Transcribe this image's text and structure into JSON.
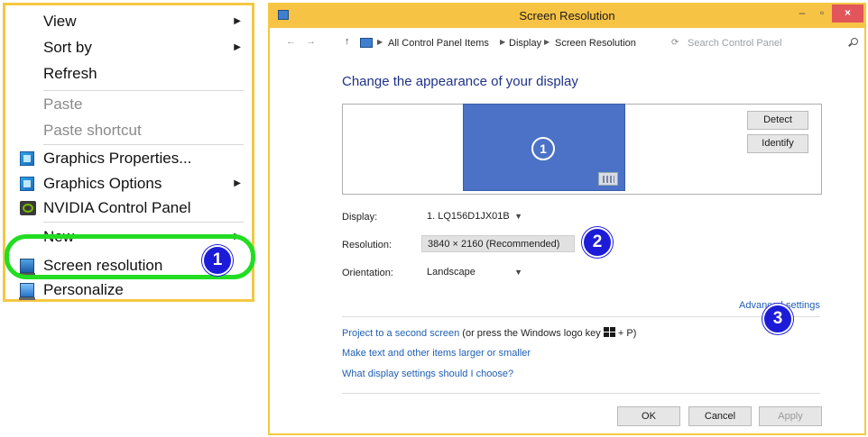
{
  "context_menu": {
    "items": [
      {
        "label": "View",
        "has_submenu": true,
        "disabled": false
      },
      {
        "label": "Sort by",
        "has_submenu": true,
        "disabled": false
      },
      {
        "label": "Refresh",
        "has_submenu": false,
        "disabled": false
      },
      {
        "label": "Paste",
        "has_submenu": false,
        "disabled": true
      },
      {
        "label": "Paste shortcut",
        "has_submenu": false,
        "disabled": true
      },
      {
        "label": "Graphics Properties...",
        "icon": "intel-graphics-icon"
      },
      {
        "label": "Graphics Options",
        "icon": "intel-graphics-icon",
        "has_submenu": true
      },
      {
        "label": "NVIDIA Control Panel",
        "icon": "nvidia-icon"
      },
      {
        "label": "New",
        "has_submenu": true
      },
      {
        "label": "Screen resolution",
        "icon": "screen-resolution-icon",
        "highlighted": true
      },
      {
        "label": "Personalize",
        "icon": "personalize-icon"
      }
    ],
    "highlight_color": "#22dd22"
  },
  "callouts": {
    "one": "1",
    "two": "2",
    "three": "3",
    "color": "#1c1cd8"
  },
  "window": {
    "title": "Screen Resolution",
    "titlebar_color": "#f7c345",
    "controls": {
      "minimize": "–",
      "maximize": "▫",
      "close": "×"
    },
    "address_bar": {
      "nav_back": "←",
      "nav_forward": "→",
      "nav_up": "↑",
      "breadcrumbs": [
        "All Control Panel Items",
        "Display",
        "Screen Resolution"
      ],
      "search_placeholder": "Search Control Panel"
    },
    "heading": "Change the appearance of your display",
    "preview": {
      "monitor_number": "1",
      "detect_label": "Detect",
      "identify_label": "Identify"
    },
    "fields": {
      "display_label": "Display:",
      "display_value": "1. LQ156D1JX01B",
      "resolution_label": "Resolution:",
      "resolution_value": "3840 × 2160 (Recommended)",
      "orientation_label": "Orientation:",
      "orientation_value": "Landscape"
    },
    "advanced_settings": "Advanced settings",
    "links": {
      "project": "Project to a second screen",
      "project_suffix_a": " (or press the Windows logo key ",
      "project_suffix_b": " + P)",
      "text_size": "Make text and other items larger or smaller",
      "which_settings": "What display settings should I choose?"
    },
    "buttons": {
      "ok": "OK",
      "cancel": "Cancel",
      "apply": "Apply"
    }
  }
}
